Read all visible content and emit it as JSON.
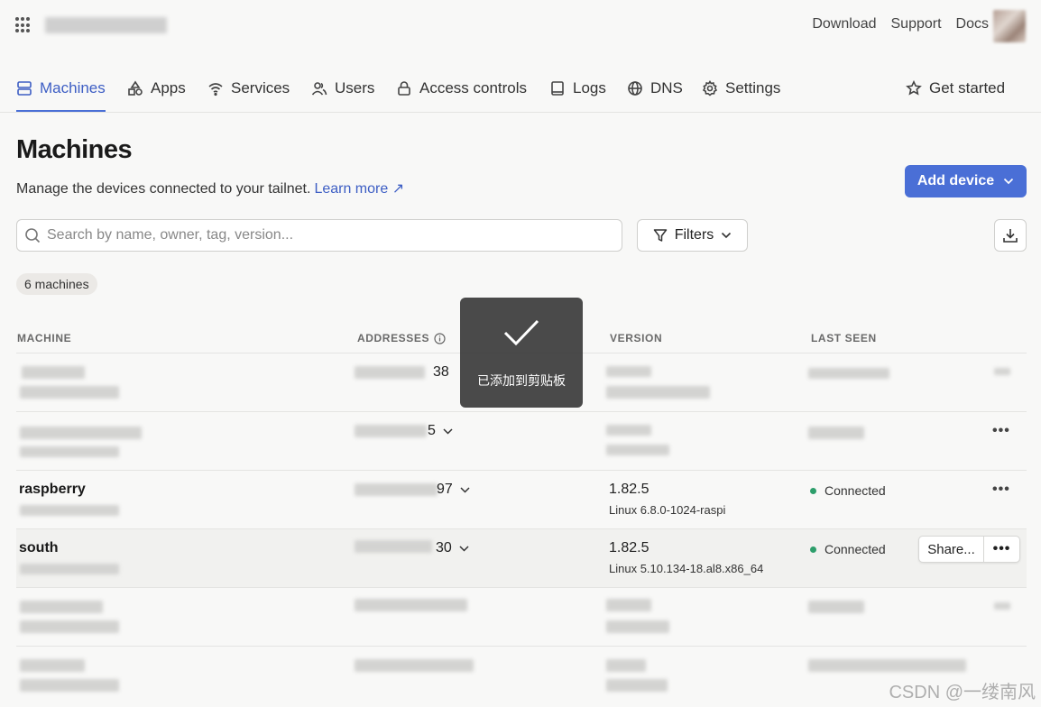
{
  "topbar": {
    "links": [
      "Download",
      "Support",
      "Docs"
    ]
  },
  "nav": {
    "items": [
      {
        "label": "Machines",
        "icon": "server-icon"
      },
      {
        "label": "Apps",
        "icon": "shapes-icon"
      },
      {
        "label": "Services",
        "icon": "wifi-icon"
      },
      {
        "label": "Users",
        "icon": "users-icon"
      },
      {
        "label": "Access controls",
        "icon": "lock-icon"
      },
      {
        "label": "Logs",
        "icon": "book-icon"
      },
      {
        "label": "DNS",
        "icon": "globe-icon"
      },
      {
        "label": "Settings",
        "icon": "gear-icon"
      }
    ],
    "get_started": "Get started"
  },
  "header": {
    "title": "Machines",
    "description": "Manage the devices connected to your tailnet.",
    "learn_more": "Learn more ↗",
    "add_device": "Add device"
  },
  "search": {
    "placeholder": "Search by name, owner, tag, version..."
  },
  "filters_label": "Filters",
  "count": "6 machines",
  "table": {
    "headers": {
      "machine": "MACHINE",
      "addresses": "ADDRESSES",
      "version": "VERSION",
      "last_seen": "LAST SEEN"
    },
    "rows": [
      {
        "name": "",
        "address_suffix": "38",
        "version": "",
        "os": "",
        "status": ""
      },
      {
        "name": "",
        "address_suffix": "5",
        "version": "",
        "os": "",
        "status": ""
      },
      {
        "name": "raspberry",
        "address_suffix": "97",
        "version": "1.82.5",
        "os": "Linux 6.8.0-1024-raspi",
        "status": "Connected"
      },
      {
        "name": "south",
        "address_suffix": "30",
        "version": "1.82.5",
        "os": "Linux 5.10.134-18.al8.x86_64",
        "status": "Connected",
        "share": "Share..."
      },
      {
        "name": "",
        "address_suffix": "",
        "version": "",
        "os": "",
        "status": ""
      },
      {
        "name": "",
        "address_suffix": "",
        "version": "",
        "os": "",
        "status": ""
      }
    ]
  },
  "toast": {
    "message": "已添加到剪贴板"
  },
  "watermark": "CSDN @一缕南风",
  "colors": {
    "accent": "#4a6fd6",
    "connected": "#2d9e6b"
  }
}
